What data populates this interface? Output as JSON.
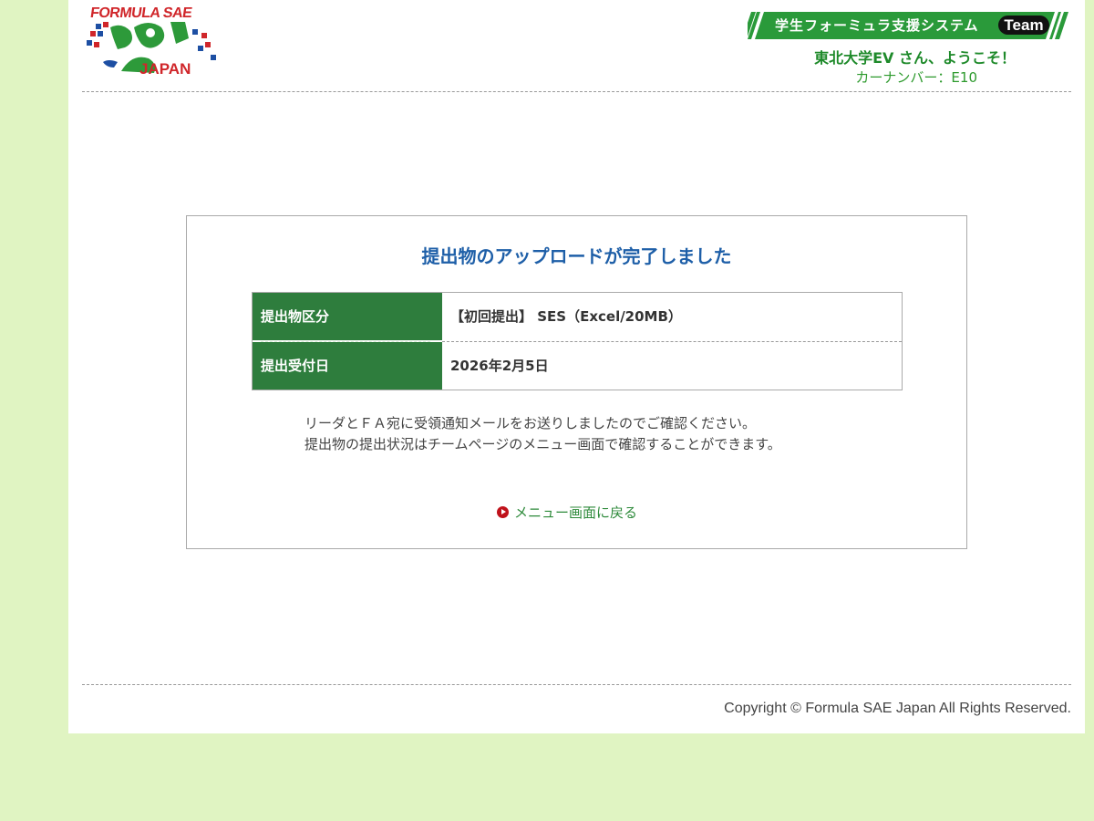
{
  "header": {
    "logo_top": "FORMULA SAE",
    "logo_bottom": "JAPAN",
    "system_title": "学生フォーミュラ支援システム",
    "team_badge": "Team",
    "welcome_team": "東北大学EV",
    "welcome_suffix": " さん、ようこそ！",
    "car_number_label": "カーナンバー：",
    "car_number": "E10"
  },
  "main": {
    "title": "提出物のアップロードが完了しました",
    "rows": [
      {
        "label": "提出物区分",
        "value": "【初回提出】 SES（Excel/20MB）"
      },
      {
        "label": "提出受付日",
        "value": "2026年2月5日"
      }
    ],
    "message_line1": "リーダとＦＡ宛に受領通知メールをお送りしましたのでご確認ください。",
    "message_line2": "提出物の提出状況はチームページのメニュー画面で確認することができます。",
    "back_link": "メニュー画面に戻る"
  },
  "footer": {
    "copyright": "Copyright © Formula SAE Japan All Rights Reserved."
  },
  "colors": {
    "page_bg": "#e0f4c2",
    "title_blue": "#1e5fa8",
    "header_green": "#2e7d3d",
    "link_green": "#2d8a3a",
    "logo_red": "#d0262a"
  }
}
